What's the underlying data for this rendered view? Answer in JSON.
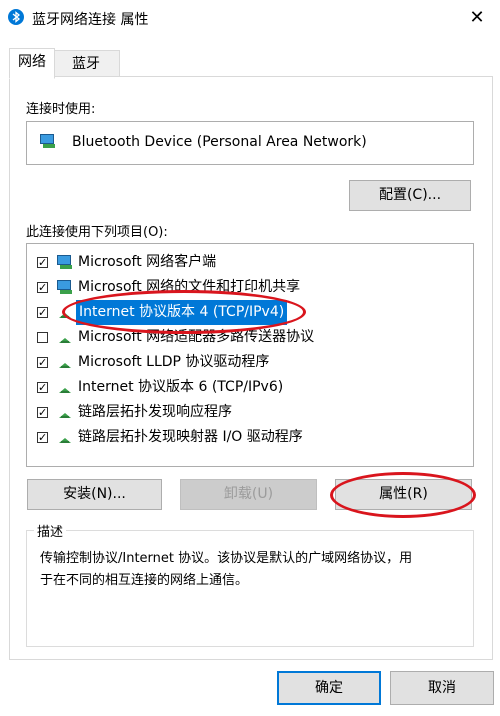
{
  "window": {
    "title": "蓝牙网络连接 属性",
    "close_glyph": "✕"
  },
  "tabs": [
    {
      "label": "网络"
    },
    {
      "label": "蓝牙"
    }
  ],
  "connect_using_label": "连接时使用:",
  "device_name": "Bluetooth Device (Personal Area Network)",
  "configure_button": {
    "text": "配置",
    "mnemonic": "(C)",
    "suffix": "..."
  },
  "items_label": "此连接使用下列项目(O):",
  "items": [
    {
      "label": "Microsoft 网络客户端",
      "checked": true,
      "icon": "network-client-icon"
    },
    {
      "label": "Microsoft 网络的文件和打印机共享",
      "checked": true,
      "icon": "network-client-icon"
    },
    {
      "label": "Internet 协议版本 4 (TCP/IPv4)",
      "checked": true,
      "icon": "protocol-icon",
      "selected": true
    },
    {
      "label": "Microsoft 网络适配器多路传送器协议",
      "checked": false,
      "icon": "protocol-icon"
    },
    {
      "label": "Microsoft LLDP 协议驱动程序",
      "checked": true,
      "icon": "protocol-icon"
    },
    {
      "label": "Internet 协议版本 6 (TCP/IPv6)",
      "checked": true,
      "icon": "protocol-icon"
    },
    {
      "label": "链路层拓扑发现响应程序",
      "checked": true,
      "icon": "protocol-icon"
    },
    {
      "label": "链路层拓扑发现映射器 I/O 驱动程序",
      "checked": true,
      "icon": "protocol-icon"
    }
  ],
  "install_button": {
    "text": "安装",
    "mnemonic": "(N)",
    "suffix": "..."
  },
  "uninstall_button": {
    "text": "卸载",
    "mnemonic": "(U)"
  },
  "properties_button": {
    "text": "属性",
    "mnemonic": "(R)"
  },
  "description": {
    "title": "描述",
    "line1": "传输控制协议/Internet 协议。该协议是默认的广域网络协议，用",
    "line2": "于在不同的相互连接的网络上通信。"
  },
  "ok_button": "确定",
  "cancel_button": "取消",
  "colors": {
    "accent": "#0078d7",
    "annotation": "#d9151d"
  }
}
